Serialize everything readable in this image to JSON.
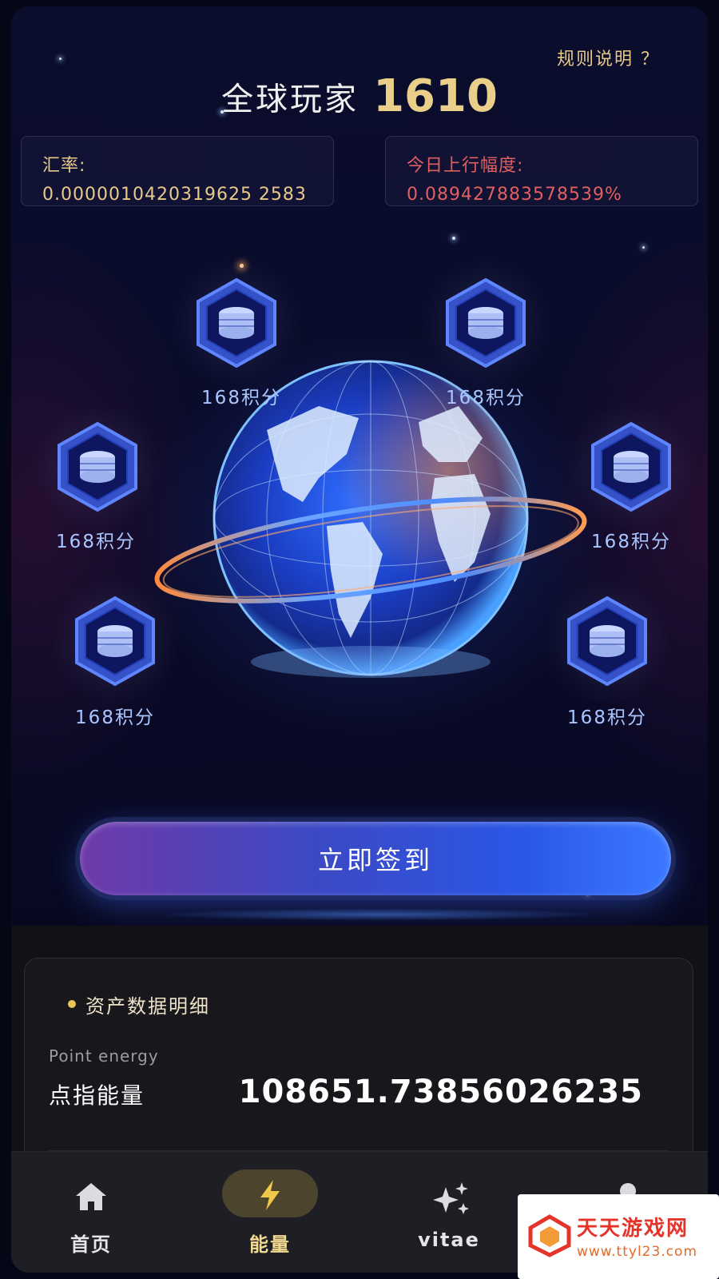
{
  "header": {
    "rules_link": "规则说明 ？",
    "title_label": "全球玩家",
    "player_count": "1610"
  },
  "stats": {
    "rate_label": "汇率:",
    "rate_value": "0.0000010420319625 2583",
    "rise_label": "今日上行幅度:",
    "rise_value": "0.089427883578539%"
  },
  "rewards": [
    {
      "label": "168积分",
      "icon": "coin-stack-icon"
    },
    {
      "label": "168积分",
      "icon": "coin-stack-icon"
    },
    {
      "label": "168积分",
      "icon": "coin-stack-icon"
    },
    {
      "label": "168积分",
      "icon": "coin-stack-icon"
    },
    {
      "label": "168积分",
      "icon": "coin-stack-icon"
    },
    {
      "label": "168积分",
      "icon": "coin-stack-icon"
    }
  ],
  "checkin_button": "立即签到",
  "asset_card": {
    "section_title": "资产数据明细",
    "name_en": "Point energy",
    "name_cn": "点指能量",
    "value": "108651.73856026235"
  },
  "nav": [
    {
      "label": "首页",
      "icon": "home-icon",
      "active": false
    },
    {
      "label": "能量",
      "icon": "lightning-icon",
      "active": true
    },
    {
      "label": "vitae",
      "icon": "sparkle-icon",
      "active": false
    },
    {
      "label": "",
      "icon": "user-icon",
      "active": false
    }
  ],
  "watermark": {
    "brand": "天天游戏网",
    "url": "www.ttyl23.com"
  },
  "colors": {
    "gold": "#e9cf8a",
    "rate_value": "#e7c98a",
    "rise_red": "#e06060",
    "accent_blue": "#3b79ff"
  }
}
